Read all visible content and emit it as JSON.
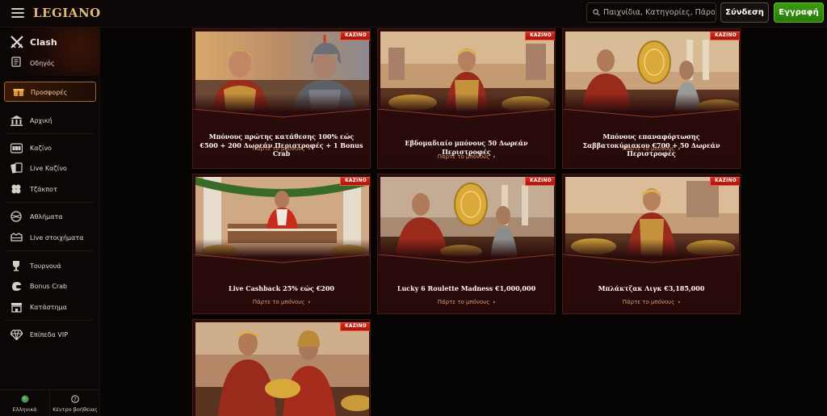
{
  "header": {
    "logo": "LEGIANO",
    "search_placeholder": "Παιχνίδια, Κατηγορίες, Πάροχοι",
    "login_label": "Σύνδεση",
    "register_label": "Εγγραφή"
  },
  "sidebar": {
    "clash_label": "Clash",
    "guide_label": "Οδηγός",
    "promotions_label": "Προσφορές",
    "home_label": "Αρχική",
    "casino_label": "Καζίνο",
    "live_casino_label": "Live Καζίνο",
    "jackpot_label": "Τζάκποτ",
    "sports_label": "Αθλήματα",
    "live_bets_label": "Live στοιχήματα",
    "tournaments_label": "Τουρνουά",
    "bonus_crab_label": "Bonus Crab",
    "shop_label": "Κατάστημα",
    "vip_label": "Επίπεδα VIP",
    "language_label": "Ελληνικά",
    "help_label": "Κέντρο βοήθειας"
  },
  "promotions": [
    {
      "badge": "ΚΑΖΙΝΟ",
      "title": "Μπόνους πρώτης κατάθεσης 100% εώς €500 + 200 Δωρεάν Περιστροφές + 1 Bonus Crab",
      "cta": "Πάρτε το μπόνους"
    },
    {
      "badge": "ΚΑΖΙΝΟ",
      "title": "Εβδομαδιαίο μπόνους 50 Δωρεάν Περιστροφές",
      "cta": "Πάρτε το μπόνους"
    },
    {
      "badge": "ΚΑΖΙΝΟ",
      "title": "Μπόνους επαναφόρτωσης Σαββατοκύριακου €700 + 50 Δωρεάν Περιστροφές",
      "cta": "Πάρτε το μπόνους"
    },
    {
      "badge": "ΚΑΖΙΝΟ",
      "title": "Live Cashback 25% εώς €200",
      "cta": "Πάρτε το μπόνους"
    },
    {
      "badge": "ΚΑΖΙΝΟ",
      "title": "Lucky 6 Roulette Madness €1,000,000",
      "cta": "Πάρτε το μπόνους"
    },
    {
      "badge": "ΚΑΖΙΝΟ",
      "title": "Μπλάκτζακ Λιγκ €3,185,000",
      "cta": "Πάρτε το μπόνους"
    },
    {
      "badge": "ΚΑΖΙΝΟ"
    }
  ],
  "colors": {
    "accent_gold": "#e0b878",
    "register_green": "#3d9b12",
    "badge_red": "#c81e14",
    "card_bg": "#2a0b0b"
  }
}
